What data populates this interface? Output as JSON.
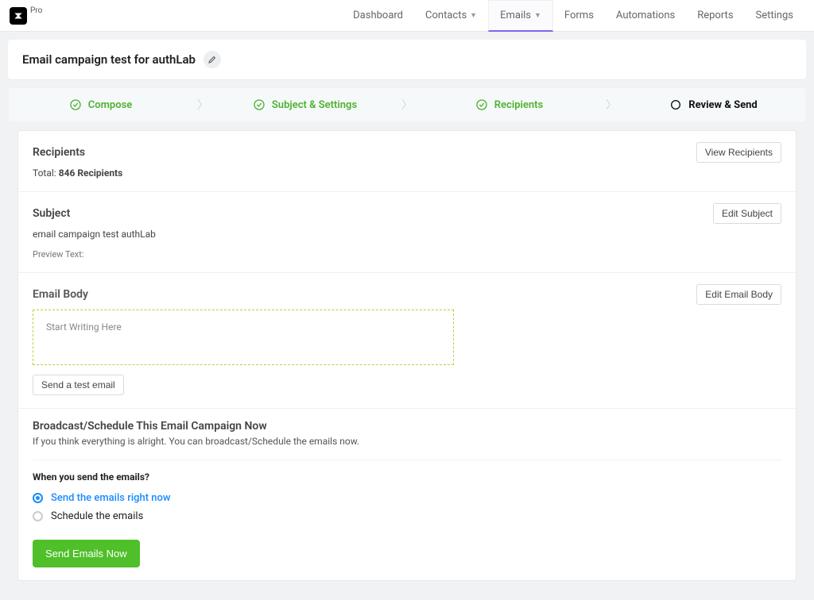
{
  "brand": {
    "pro_label": "Pro"
  },
  "nav": {
    "dashboard": "Dashboard",
    "contacts": "Contacts",
    "emails": "Emails",
    "forms": "Forms",
    "automations": "Automations",
    "reports": "Reports",
    "settings": "Settings"
  },
  "header": {
    "title": "Email campaign test for authLab"
  },
  "steps": {
    "compose": "Compose",
    "subject": "Subject & Settings",
    "recipients": "Recipients",
    "review": "Review & Send"
  },
  "recipients": {
    "title": "Recipients",
    "total_prefix": "Total: ",
    "total_value": "846 Recipients",
    "view_btn": "View Recipients"
  },
  "subject": {
    "title": "Subject",
    "line": "email campaign test authLab",
    "preview_label": "Preview Text:",
    "edit_btn": "Edit Subject"
  },
  "body": {
    "title": "Email Body",
    "placeholder": "Start Writing Here",
    "edit_btn": "Edit Email Body",
    "send_test_btn": "Send a test email"
  },
  "broadcast": {
    "title": "Broadcast/Schedule This Email Campaign Now",
    "desc": "If you think everything is alright. You can broadcast/Schedule the emails now.",
    "when_q": "When you send the emails?",
    "opt_now": "Send the emails right now",
    "opt_schedule": "Schedule the emails",
    "send_btn": "Send Emails Now"
  }
}
